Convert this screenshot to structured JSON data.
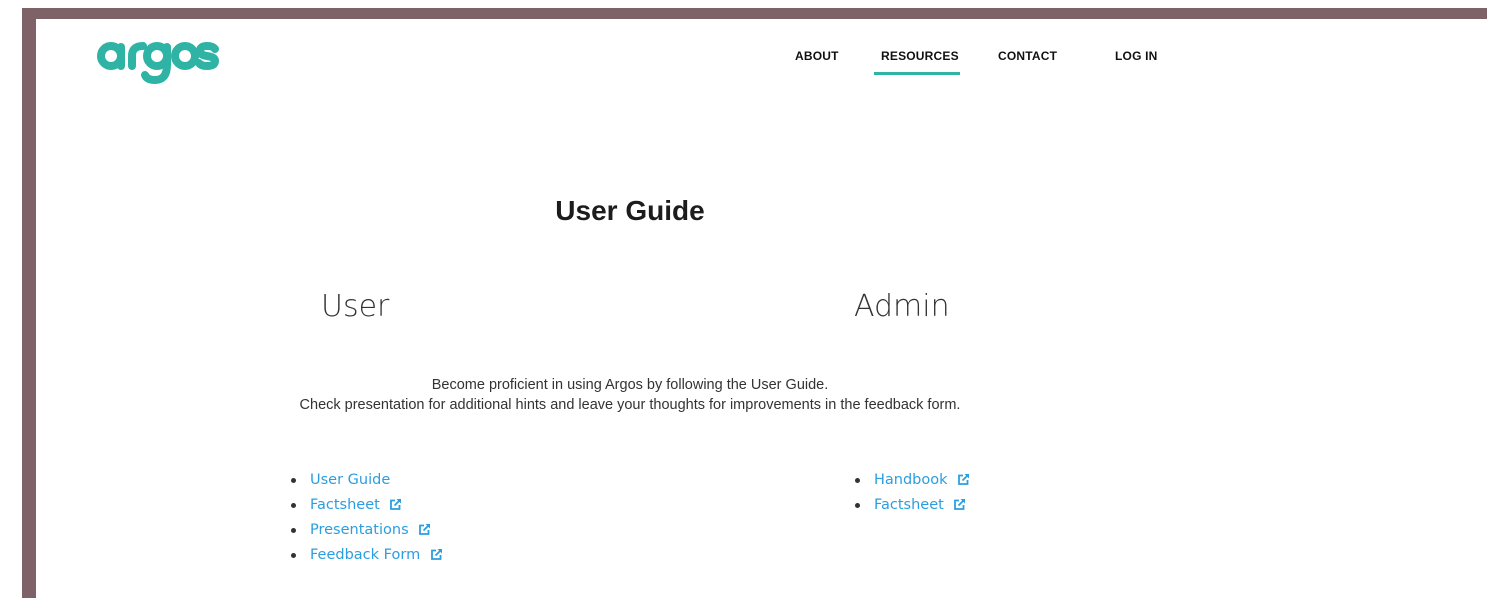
{
  "brand": {
    "logo_text": "argos",
    "color": "#2fb3a5"
  },
  "nav": {
    "items": [
      {
        "label": "ABOUT"
      },
      {
        "label": "RESOURCES",
        "active": true
      },
      {
        "label": "CONTACT"
      },
      {
        "label": "LOG IN"
      }
    ]
  },
  "main": {
    "title": "User Guide",
    "user": {
      "heading": "User",
      "links": [
        {
          "label": "User Guide",
          "external": false
        },
        {
          "label": "Factsheet",
          "external": true
        },
        {
          "label": "Presentations",
          "external": true
        },
        {
          "label": "Feedback Form",
          "external": true
        }
      ]
    },
    "admin": {
      "heading": "Admin",
      "links": [
        {
          "label": "Handbook",
          "external": true
        },
        {
          "label": "Factsheet",
          "external": true
        }
      ]
    },
    "intro": {
      "line1": "Become proficient in using Argos by following the User Guide.",
      "line2": "Check presentation for additional hints and leave your thoughts for improvements in the feedback form."
    }
  },
  "colors": {
    "frame": "#7e6268",
    "accent": "#2fb3a5",
    "link": "#2b9ee0"
  },
  "icons": {
    "external": "external-link-icon"
  }
}
